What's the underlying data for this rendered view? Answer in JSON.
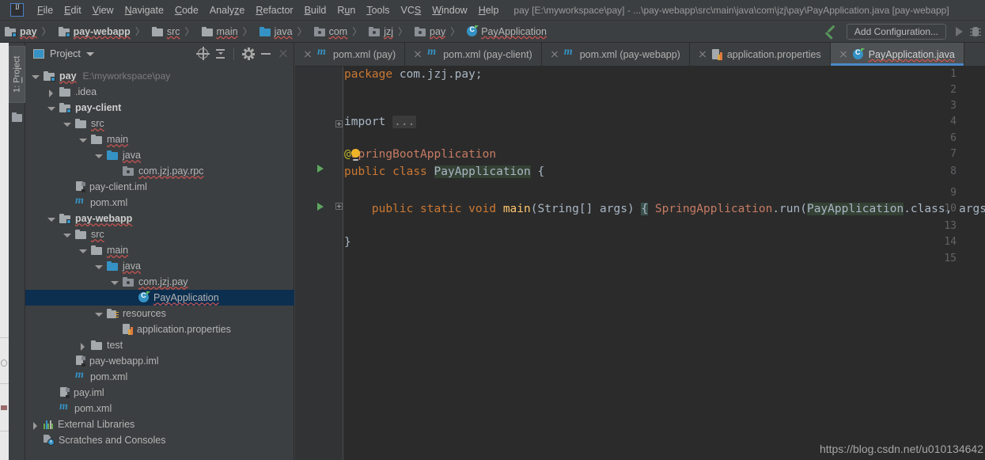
{
  "window": {
    "title": "pay [E:\\myworkspace\\pay] - ...\\pay-webapp\\src\\main\\java\\com\\jzj\\pay\\PayApplication.java [pay-webapp]",
    "logo": "intellij-idea-logo"
  },
  "menubar": {
    "items": [
      {
        "pre": "",
        "mn": "F",
        "post": "ile"
      },
      {
        "pre": "",
        "mn": "E",
        "post": "dit"
      },
      {
        "pre": "",
        "mn": "V",
        "post": "iew"
      },
      {
        "pre": "",
        "mn": "N",
        "post": "avigate"
      },
      {
        "pre": "",
        "mn": "C",
        "post": "ode"
      },
      {
        "pre": "Analy",
        "mn": "z",
        "post": "e"
      },
      {
        "pre": "",
        "mn": "R",
        "post": "efactor"
      },
      {
        "pre": "",
        "mn": "B",
        "post": "uild"
      },
      {
        "pre": "R",
        "mn": "u",
        "post": "n"
      },
      {
        "pre": "",
        "mn": "T",
        "post": "ools"
      },
      {
        "pre": "VC",
        "mn": "S",
        "post": ""
      },
      {
        "pre": "",
        "mn": "W",
        "post": "indow"
      },
      {
        "pre": "",
        "mn": "H",
        "post": "elp"
      }
    ]
  },
  "navbar": {
    "crumbs": [
      {
        "label": "pay",
        "icon": "module-folder-icon",
        "bold": true,
        "wavy": true
      },
      {
        "label": "pay-webapp",
        "icon": "module-folder-icon",
        "bold": true,
        "wavy": true
      },
      {
        "label": "src",
        "icon": "folder-icon",
        "bold": false,
        "wavy": true
      },
      {
        "label": "main",
        "icon": "folder-icon",
        "bold": false,
        "wavy": true
      },
      {
        "label": "java",
        "icon": "sources-folder-icon",
        "bold": false,
        "wavy": true
      },
      {
        "label": "com",
        "icon": "package-icon",
        "bold": false,
        "wavy": true
      },
      {
        "label": "jzj",
        "icon": "package-icon",
        "bold": false,
        "wavy": true
      },
      {
        "label": "pay",
        "icon": "package-icon",
        "bold": false,
        "wavy": true
      },
      {
        "label": "PayApplication",
        "icon": "java-class-icon",
        "bold": false,
        "wavy": true
      }
    ],
    "separator": "〉",
    "add_configuration": "Add Configuration...",
    "run_icon": "run-anything-arrow-icon",
    "play_icon": "run-icon",
    "debug_icon": "debug-icon"
  },
  "toolstrip": {
    "project_tab_pre": "1: ",
    "project_tab_mn": "P",
    "project_tab_post": "roject",
    "folder_icon": "folder-icon"
  },
  "project_panel": {
    "title": "Project",
    "view_icon": "project-view-icon",
    "dropdown_icon": "chevron-down-icon",
    "buttons": [
      {
        "name": "locate-icon"
      },
      {
        "name": "collapse-all-icon"
      },
      {
        "name": "settings-gear-icon"
      },
      {
        "name": "hide-icon"
      },
      {
        "name": "close-icon"
      }
    ],
    "tree": [
      {
        "indent": 0,
        "twisty": "down",
        "icon": "module-folder-icon",
        "label": "pay",
        "bold": true,
        "wavy": true,
        "path": "E:\\myworkspace\\pay",
        "selected": false
      },
      {
        "indent": 1,
        "twisty": "right",
        "icon": "folder-icon",
        "label": ".idea",
        "bold": false,
        "wavy": false,
        "path": "",
        "selected": false
      },
      {
        "indent": 1,
        "twisty": "down",
        "icon": "module-folder-icon",
        "label": "pay-client",
        "bold": true,
        "wavy": false,
        "path": "",
        "selected": false
      },
      {
        "indent": 2,
        "twisty": "down",
        "icon": "folder-icon",
        "label": "src",
        "bold": false,
        "wavy": true,
        "path": "",
        "selected": false
      },
      {
        "indent": 3,
        "twisty": "down",
        "icon": "folder-icon",
        "label": "main",
        "bold": false,
        "wavy": true,
        "path": "",
        "selected": false
      },
      {
        "indent": 4,
        "twisty": "down",
        "icon": "sources-folder-icon",
        "label": "java",
        "bold": false,
        "wavy": true,
        "path": "",
        "selected": false
      },
      {
        "indent": 5,
        "twisty": "none",
        "icon": "package-icon",
        "label": "com.jzj.pay.rpc",
        "bold": false,
        "wavy": true,
        "path": "",
        "selected": false
      },
      {
        "indent": 2,
        "twisty": "none",
        "icon": "iml-file-icon",
        "label": "pay-client.iml",
        "bold": false,
        "wavy": false,
        "path": "",
        "selected": false
      },
      {
        "indent": 2,
        "twisty": "none",
        "icon": "maven-pom-icon",
        "label": "pom.xml",
        "bold": false,
        "wavy": false,
        "path": "",
        "selected": false
      },
      {
        "indent": 1,
        "twisty": "down",
        "icon": "module-folder-icon",
        "label": "pay-webapp",
        "bold": true,
        "wavy": true,
        "path": "",
        "selected": false
      },
      {
        "indent": 2,
        "twisty": "down",
        "icon": "folder-icon",
        "label": "src",
        "bold": false,
        "wavy": true,
        "path": "",
        "selected": false
      },
      {
        "indent": 3,
        "twisty": "down",
        "icon": "folder-icon",
        "label": "main",
        "bold": false,
        "wavy": true,
        "path": "",
        "selected": false
      },
      {
        "indent": 4,
        "twisty": "down",
        "icon": "sources-folder-icon",
        "label": "java",
        "bold": false,
        "wavy": true,
        "path": "",
        "selected": false
      },
      {
        "indent": 5,
        "twisty": "down",
        "icon": "package-icon",
        "label": "com.jzj.pay",
        "bold": false,
        "wavy": true,
        "path": "",
        "selected": false
      },
      {
        "indent": 6,
        "twisty": "none",
        "icon": "java-class-icon",
        "label": "PayApplication",
        "bold": false,
        "wavy": true,
        "path": "",
        "selected": true
      },
      {
        "indent": 4,
        "twisty": "down",
        "icon": "resources-folder-icon",
        "label": "resources",
        "bold": false,
        "wavy": false,
        "path": "",
        "selected": false
      },
      {
        "indent": 5,
        "twisty": "none",
        "icon": "properties-file-icon",
        "label": "application.properties",
        "bold": false,
        "wavy": false,
        "path": "",
        "selected": false
      },
      {
        "indent": 3,
        "twisty": "right",
        "icon": "folder-icon",
        "label": "test",
        "bold": false,
        "wavy": false,
        "path": "",
        "selected": false
      },
      {
        "indent": 2,
        "twisty": "none",
        "icon": "iml-file-icon",
        "label": "pay-webapp.iml",
        "bold": false,
        "wavy": false,
        "path": "",
        "selected": false
      },
      {
        "indent": 2,
        "twisty": "none",
        "icon": "maven-pom-icon",
        "label": "pom.xml",
        "bold": false,
        "wavy": false,
        "path": "",
        "selected": false
      },
      {
        "indent": 1,
        "twisty": "none",
        "icon": "iml-file-icon",
        "label": "pay.iml",
        "bold": false,
        "wavy": false,
        "path": "",
        "selected": false
      },
      {
        "indent": 1,
        "twisty": "none",
        "icon": "maven-pom-icon",
        "label": "pom.xml",
        "bold": false,
        "wavy": false,
        "path": "",
        "selected": false
      },
      {
        "indent": 0,
        "twisty": "right",
        "icon": "external-libraries-icon",
        "label": "External Libraries",
        "bold": false,
        "wavy": false,
        "path": "",
        "selected": false
      },
      {
        "indent": 0,
        "twisty": "none",
        "icon": "scratches-icon",
        "label": "Scratches and Consoles",
        "bold": false,
        "wavy": false,
        "path": "",
        "selected": false
      }
    ]
  },
  "editor": {
    "tabs": [
      {
        "label": "pom.xml (pay)",
        "icon": "maven-pom-icon",
        "active": false,
        "wavy": false
      },
      {
        "label": "pom.xml (pay-client)",
        "icon": "maven-pom-icon",
        "active": false,
        "wavy": false
      },
      {
        "label": "pom.xml (pay-webapp)",
        "icon": "maven-pom-icon",
        "active": false,
        "wavy": false
      },
      {
        "label": "application.properties",
        "icon": "properties-file-icon",
        "active": false,
        "wavy": false
      },
      {
        "label": "PayApplication.java",
        "icon": "java-class-icon",
        "active": true,
        "wavy": true
      }
    ],
    "line_numbers": [
      "1",
      "2",
      "3",
      "4",
      "6",
      "7",
      "8",
      "9",
      "10",
      "13",
      "14",
      "15"
    ],
    "code": {
      "l1_kw": "package",
      "l1_rest": " com.jzj.pay;",
      "l4_import": "import",
      "l4_fold": "...",
      "l7_at": "@",
      "l7_ann": "SpringBootApplication",
      "l8_kw1": "public",
      "l8_kw2": "class",
      "l8_cls": "PayApplication",
      "l8_brace": "{",
      "l10_kw1": "public",
      "l10_kw2": "static",
      "l10_kw3": "void",
      "l10_method": "main",
      "l10_params": "(String[] args)",
      "l10_open": "{",
      "l10_call_cls": "SpringApplication",
      "l10_dot_run": ".run(",
      "l10_arg_cls": "PayApplication",
      "l10_arg_rest": ".class, args);",
      "l10_close": "}",
      "l14_close": "}"
    },
    "watermark": "https://blog.csdn.net/u010134642"
  },
  "colors": {
    "accent_blue": "#3592c4",
    "tab_underline": "#4a88c7",
    "selection": "#0d2f4f",
    "editor_bg": "#2b2b2b",
    "panel_bg": "#3c3f41",
    "keyword": "#cc7832",
    "annotation": "#bbb529",
    "method": "#ffc66d",
    "error_wave": "#c75450"
  }
}
